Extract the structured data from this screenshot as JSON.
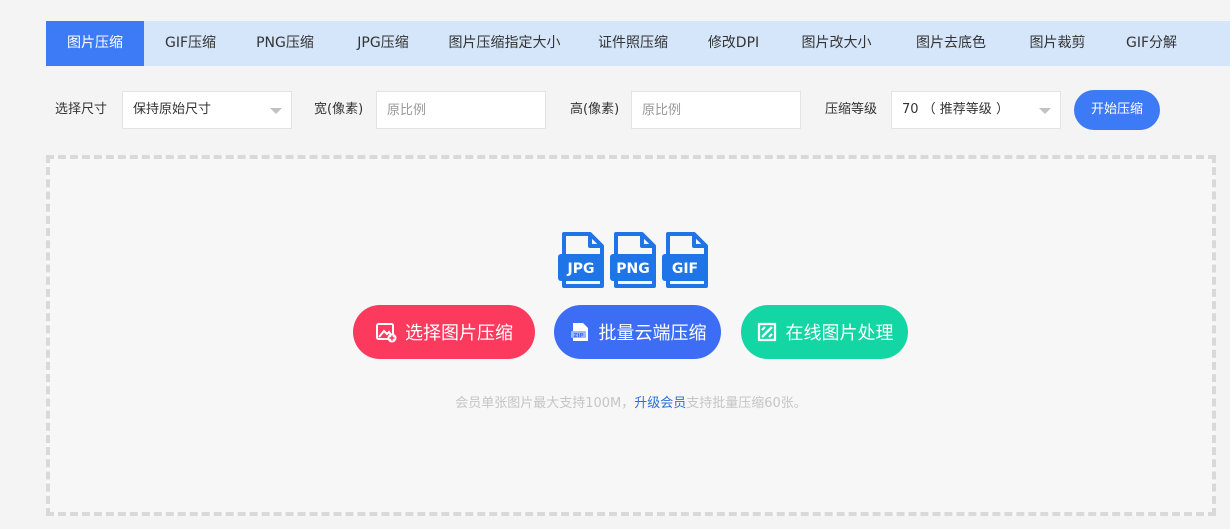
{
  "tabs": [
    {
      "label": "图片压缩",
      "active": true
    },
    {
      "label": "GIF压缩"
    },
    {
      "label": "PNG压缩"
    },
    {
      "label": "JPG压缩"
    },
    {
      "label": "图片压缩指定大小"
    },
    {
      "label": "证件照压缩"
    },
    {
      "label": "修改DPI"
    },
    {
      "label": "图片改大小"
    },
    {
      "label": "图片去底色"
    },
    {
      "label": "图片裁剪"
    },
    {
      "label": "GIF分解"
    }
  ],
  "controls": {
    "size_label": "选择尺寸",
    "size_value": "保持原始尺寸",
    "width_label": "宽(像素)",
    "width_placeholder": "原比例",
    "height_label": "高(像素)",
    "height_placeholder": "原比例",
    "level_label": "压缩等级",
    "level_value": "70 （ 推荐等级 ）",
    "start_button": "开始压缩"
  },
  "dropzone": {
    "file_types": [
      "JPG",
      "PNG",
      "GIF"
    ],
    "buttons": {
      "select": "选择图片压缩",
      "batch": "批量云端压缩",
      "online": "在线图片处理"
    },
    "hint_before": "会员单张图片最大支持100M，",
    "hint_link": "升级会员",
    "hint_after": "支持批量压缩60张。"
  },
  "colors": {
    "accent": "#3d7af6",
    "tab_bar": "#d5e6fa",
    "red": "#fb3a5d",
    "blue": "#3d6df5",
    "green": "#14d6a4"
  }
}
